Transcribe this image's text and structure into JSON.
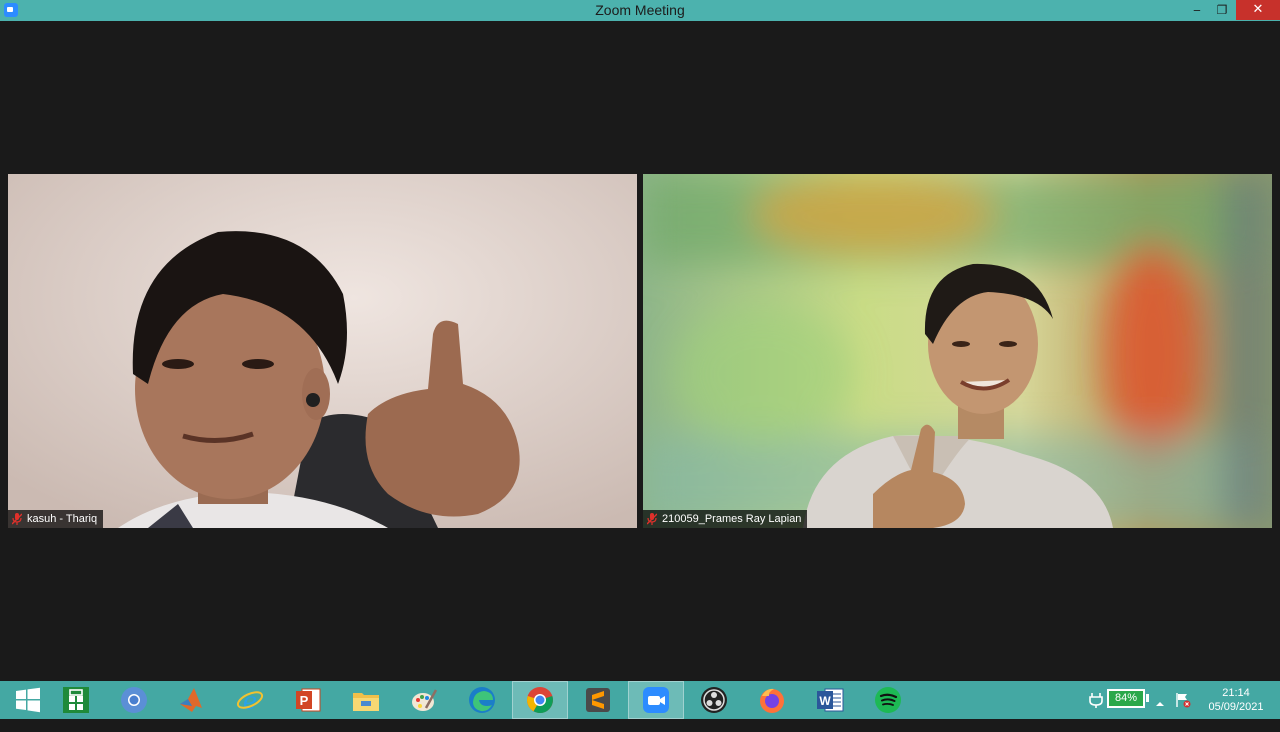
{
  "window": {
    "title": "Zoom Meeting",
    "minimize_glyph": "‒",
    "maximize_glyph": "❐",
    "close_glyph": "✕"
  },
  "participants": [
    {
      "name": "kasuh - Thariq",
      "muted": true
    },
    {
      "name": "210059_Prames Ray Lapian",
      "muted": true
    }
  ],
  "taskbar": {
    "apps": [
      {
        "name": "start",
        "icon": "windows-logo-icon"
      },
      {
        "name": "store",
        "icon": "microsoft-store-icon"
      },
      {
        "name": "chromium",
        "icon": "chromium-icon"
      },
      {
        "name": "matlab",
        "icon": "matlab-icon"
      },
      {
        "name": "internet-explorer",
        "icon": "internet-explorer-icon"
      },
      {
        "name": "powerpoint",
        "icon": "powerpoint-icon"
      },
      {
        "name": "file-explorer",
        "icon": "file-explorer-icon"
      },
      {
        "name": "paint",
        "icon": "paint-icon"
      },
      {
        "name": "edge",
        "icon": "edge-icon"
      },
      {
        "name": "chrome",
        "icon": "chrome-icon"
      },
      {
        "name": "sublime-text",
        "icon": "sublime-text-icon"
      },
      {
        "name": "zoom",
        "icon": "zoom-icon"
      },
      {
        "name": "obs",
        "icon": "obs-icon"
      },
      {
        "name": "firefox",
        "icon": "firefox-icon"
      },
      {
        "name": "word",
        "icon": "word-icon"
      },
      {
        "name": "spotify",
        "icon": "spotify-icon"
      }
    ],
    "battery_percent": "84%",
    "time": "21:14",
    "date": "05/09/2021",
    "colors": {
      "bar": "#44a8a3",
      "titlebar": "#4cb2ae",
      "battery": "#2aa84a"
    }
  }
}
